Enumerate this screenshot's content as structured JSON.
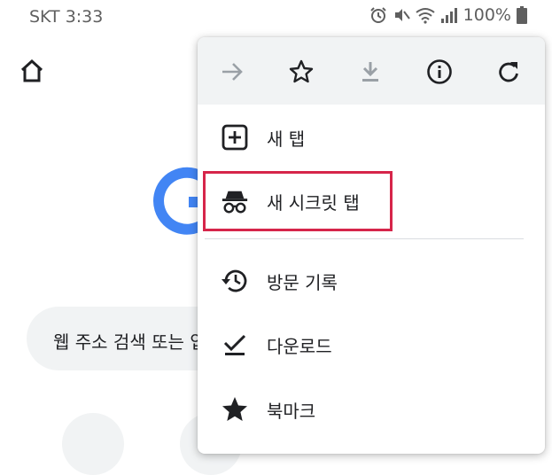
{
  "status_bar": {
    "carrier_time": "SKT 3:33",
    "battery_percent": "100%",
    "icons": [
      "alarm-icon",
      "mute-icon",
      "wifi-icon",
      "signal-icon",
      "battery-icon"
    ]
  },
  "background_page": {
    "search_placeholder": "웹 주소 검색 또는 입"
  },
  "menu": {
    "toolbar_icons": [
      "forward-icon",
      "bookmark-star-icon",
      "download-icon",
      "info-icon",
      "refresh-icon"
    ],
    "items": [
      {
        "label": "새 탭",
        "icon": "new-tab-icon"
      },
      {
        "label": "새 시크릿 탭",
        "icon": "incognito-icon"
      },
      {
        "label": "방문 기록",
        "icon": "history-icon"
      },
      {
        "label": "다운로드",
        "icon": "download-check-icon"
      },
      {
        "label": "북마크",
        "icon": "star-icon"
      }
    ]
  },
  "colors": {
    "highlight": "#d6254a",
    "toolbar_bg": "#f1f3f4",
    "google_blue": "#4285f4",
    "icon_dark": "#202124",
    "icon_disabled": "#9aa0a6"
  }
}
